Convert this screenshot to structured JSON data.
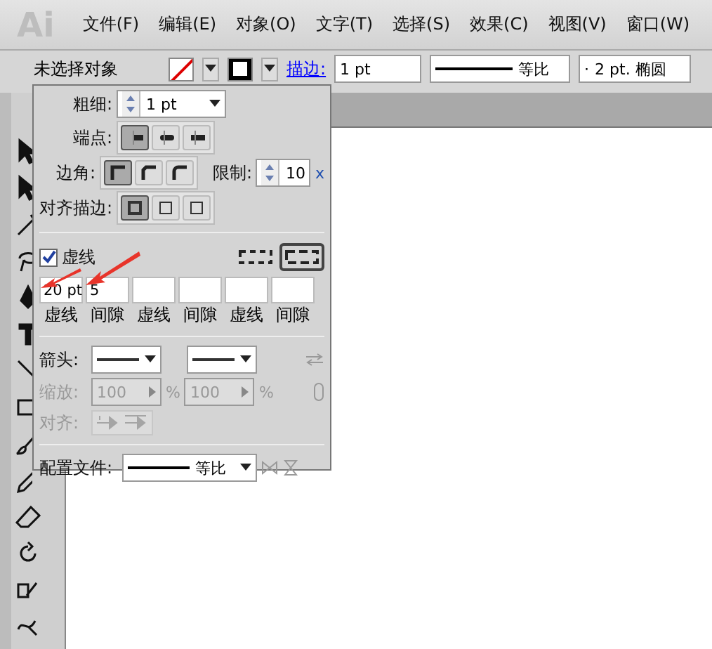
{
  "logo": "Ai",
  "menu": [
    "文件(F)",
    "编辑(E)",
    "对象(O)",
    "文字(T)",
    "选择(S)",
    "效果(C)",
    "视图(V)",
    "窗口(W)"
  ],
  "control_bar": {
    "selection": "未选择对象",
    "stroke_label": "描边:",
    "weight": "1 pt",
    "profile": "等比",
    "brush_dot": "·",
    "brush": "2 pt. 椭圆"
  },
  "stroke_panel": {
    "weight": {
      "label": "粗细:",
      "value": "1 pt"
    },
    "cap": {
      "label": "端点:",
      "options": [
        {
          "selected": true
        },
        {
          "selected": false
        },
        {
          "selected": false
        }
      ]
    },
    "corner": {
      "label": "边角:",
      "options": [
        {
          "selected": true
        },
        {
          "selected": false
        },
        {
          "selected": false
        }
      ]
    },
    "limit": {
      "label": "限制:",
      "value": "10",
      "suffix": "x"
    },
    "align": {
      "label": "对齐描边:",
      "options": [
        {
          "selected": true
        },
        {
          "selected": false
        },
        {
          "selected": false
        }
      ]
    },
    "dashed": {
      "label": "虚线",
      "checked": true
    },
    "dash_style": [
      {
        "selected": false
      },
      {
        "selected": true
      }
    ],
    "dash_fields": [
      {
        "value": "20 pt",
        "label": "虚线"
      },
      {
        "value": "5",
        "label": "间隙"
      },
      {
        "label": "虚线"
      },
      {
        "label": "间隙"
      },
      {
        "label": "虚线"
      },
      {
        "label": "间隙"
      }
    ],
    "arrowheads": {
      "label": "箭头:"
    },
    "scale": {
      "label": "缩放:",
      "values": [
        "100",
        "100"
      ],
      "unit": "%",
      "disabled": true
    },
    "arrow_align": {
      "label": "对齐:",
      "disabled": true
    },
    "profile": {
      "label": "配置文件:",
      "value": "等比"
    }
  }
}
